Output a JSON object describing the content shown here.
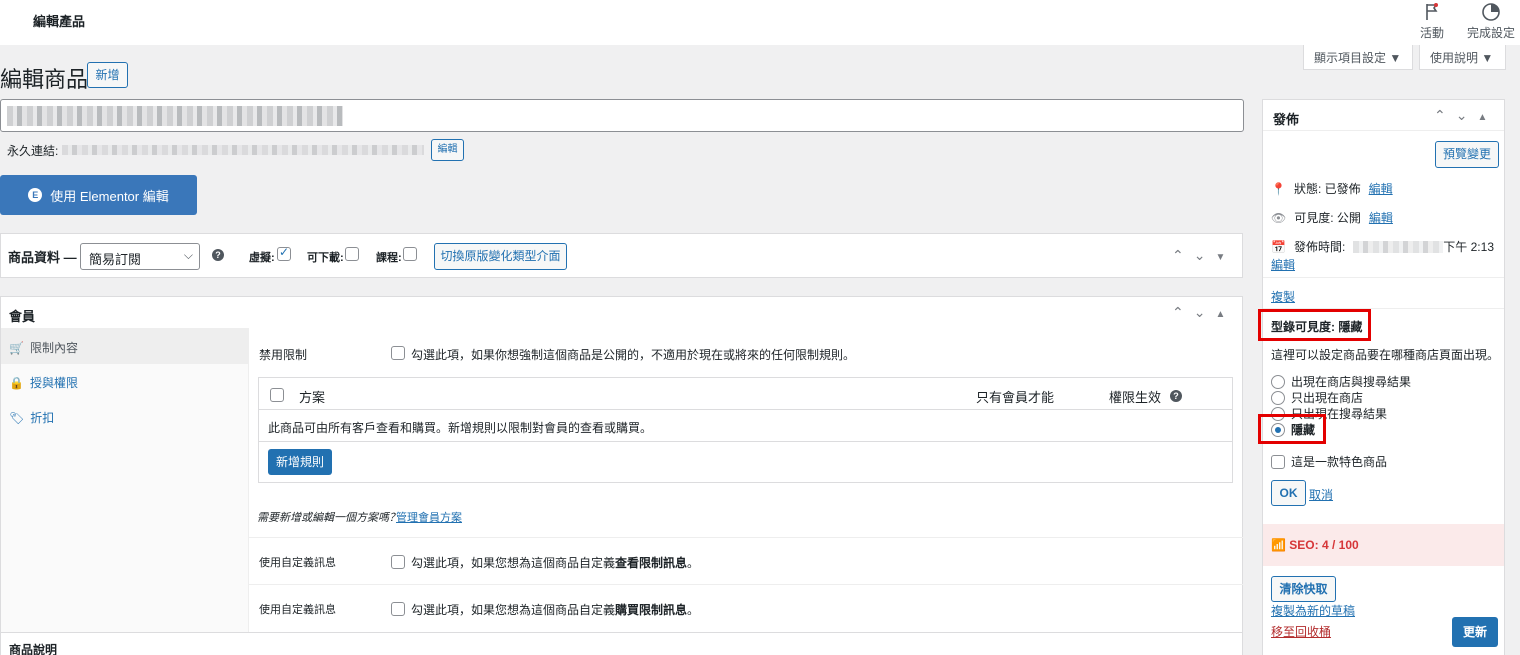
{
  "topbar": {
    "title": "編輯產品",
    "activity_label": "活動",
    "finish_setup_label": "完成設定"
  },
  "screen_options": {
    "display_label": "顯示項目設定 ▼",
    "help_label": "使用說明 ▼"
  },
  "page": {
    "heading": "編輯商品",
    "add_new_label": "新增"
  },
  "permalink": {
    "label": "永久連結:",
    "edit_label": "編輯"
  },
  "elementor": {
    "label": "使用 Elementor 編輯"
  },
  "product_data": {
    "label": "商品資料 —",
    "type_selected": "簡易訂閱",
    "virtual_label": "虛擬:",
    "virtual_checked": true,
    "downloadable_label": "可下載:",
    "downloadable_checked": false,
    "course_label": "課程:",
    "course_checked": false,
    "switch_button": "切換原版變化類型介面"
  },
  "membership": {
    "title": "會員",
    "sidebar": [
      {
        "label": "限制內容",
        "icon": "cart-icon"
      },
      {
        "label": "授與權限",
        "icon": "lock-icon"
      },
      {
        "label": "折扣",
        "icon": "tag-icon"
      }
    ],
    "disable_restriction_label": "禁用限制",
    "disable_restriction_text": "勾選此項，如果你想強制這個商品是公開的，不適用於現在或將來的任何限制規則。",
    "table": {
      "col_plan": "方案",
      "col_members_only": "只有會員才能",
      "col_effective": "權限生效",
      "empty_text": "此商品可由所有客戶查看和購買。新增規則以限制對會員的查看或購買。",
      "add_rule_button": "新增規則"
    },
    "need_plan_text": "需要新增或編輯一個方案嗎？",
    "manage_plans_link": "管理會員方案",
    "custom_msg_label_1": "使用自定義訊息",
    "custom_msg_text_1a": "勾選此項，如果您想為這個商品自定義",
    "custom_msg_text_1b": "查看限制訊息",
    "custom_msg_label_2": "使用自定義訊息",
    "custom_msg_text_2a": "勾選此項，如果您想為這個商品自定義",
    "custom_msg_text_2b": "購買限制訊息",
    "period": "。"
  },
  "product_description": {
    "title": "商品說明"
  },
  "publish": {
    "title": "發佈",
    "preview_button": "預覽變更",
    "status_label": "狀態: 已發佈",
    "status_edit": "編輯",
    "visibility_label": "可見度: 公開",
    "visibility_edit": "編輯",
    "publish_time_label": "發佈時間:",
    "publish_time_value": "下午 2:13",
    "publish_time_edit": "編輯",
    "copy_link": "複製",
    "catalog_visibility_label": "型錄可見度: 隱藏",
    "catalog_visibility_desc": "這裡可以設定商品要在哪種商店頁面出現。",
    "options": [
      {
        "label": "出現在商店與搜尋結果",
        "selected": false
      },
      {
        "label": "只出現在商店",
        "selected": false
      },
      {
        "label": "只出現在搜尋結果",
        "selected": false
      },
      {
        "label": "隱藏",
        "selected": true
      }
    ],
    "featured_label": "這是一款特色商品",
    "ok_button": "OK",
    "cancel_link": "取消",
    "seo_label": "SEO: 4 / 100",
    "clear_cache_button": "清除快取",
    "duplicate_draft_link": "複製為新的草稿",
    "trash_link": "移至回收桶",
    "update_button": "更新"
  },
  "colors": {
    "primary": "#2271b1",
    "highlight_box": "#e30000",
    "seo_bg": "#fbeaea",
    "seo_text": "#d63638",
    "trash": "#b32d2e"
  }
}
